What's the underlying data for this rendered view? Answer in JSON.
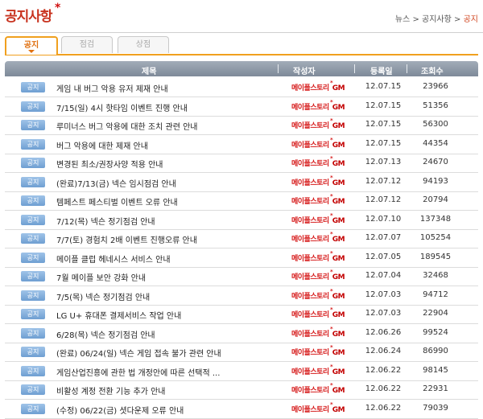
{
  "header": {
    "title": "공지사항",
    "title_star": "*",
    "breadcrumb": {
      "home": "뉴스",
      "sep1": " > ",
      "section": "공지사항",
      "sep2": " > ",
      "current": "공지"
    }
  },
  "tabs": [
    {
      "label": "공지",
      "active": true
    },
    {
      "label": "점검",
      "active": false
    },
    {
      "label": "상점",
      "active": false
    }
  ],
  "table": {
    "columns": {
      "subject": "제목",
      "author": "작성자",
      "date": "등록일",
      "views": "조회수"
    },
    "author_label": {
      "brand": "메이플스토리",
      "star": "*",
      "suffix": "GM"
    },
    "rows": [
      {
        "badge": "공지",
        "subject": "게임 내 버그 악용 유저 제재 안내",
        "date": "12.07.15",
        "views": "23966"
      },
      {
        "badge": "공지",
        "subject": "7/15(일) 4시 핫타임 이벤트 진행 안내",
        "date": "12.07.15",
        "views": "51356"
      },
      {
        "badge": "공지",
        "subject": "루미너스 버그 악용에 대한 조치 관련 안내",
        "date": "12.07.15",
        "views": "56300"
      },
      {
        "badge": "공지",
        "subject": "버그 악용에 대한 제재 안내",
        "date": "12.07.15",
        "views": "44354"
      },
      {
        "badge": "공지",
        "subject": "변경된 최소/권장사양 적용 안내",
        "date": "12.07.13",
        "views": "24670"
      },
      {
        "badge": "공지",
        "subject": "(완료)7/13(금) 넥슨 임시점검 안내",
        "date": "12.07.12",
        "views": "94193"
      },
      {
        "badge": "공지",
        "subject": "템페스트 페스티벌 이벤트 오류 안내",
        "date": "12.07.12",
        "views": "20794"
      },
      {
        "badge": "공지",
        "subject": "7/12(목) 넥슨 정기점검 안내",
        "date": "12.07.10",
        "views": "137348"
      },
      {
        "badge": "공지",
        "subject": "7/7(토) 경험치 2배 이벤트 진행오류 안내",
        "date": "12.07.07",
        "views": "105254"
      },
      {
        "badge": "공지",
        "subject": "메이플 클럽 헤네시스 서비스 안내",
        "date": "12.07.05",
        "views": "189545"
      },
      {
        "badge": "공지",
        "subject": "7월 메이플 보안 강화 안내",
        "date": "12.07.04",
        "views": "32468"
      },
      {
        "badge": "공지",
        "subject": "7/5(목) 넥슨 정기점검 안내",
        "date": "12.07.03",
        "views": "94712"
      },
      {
        "badge": "공지",
        "subject": "LG U+ 휴대폰 결제서비스 작업 안내",
        "date": "12.07.03",
        "views": "22904"
      },
      {
        "badge": "공지",
        "subject": "6/28(목) 넥슨 정기점검 안내",
        "date": "12.06.26",
        "views": "99524"
      },
      {
        "badge": "공지",
        "subject": "(완료) 06/24(일) 넥슨 게임 접속 불가 관련 안내",
        "date": "12.06.24",
        "views": "86990"
      },
      {
        "badge": "공지",
        "subject": "게임산업진흥에 관한 법 개정안에 따른 선택적 ...",
        "date": "12.06.22",
        "views": "98145"
      },
      {
        "badge": "공지",
        "subject": "비활성 계정 전환 기능 추가 안내",
        "date": "12.06.22",
        "views": "22931"
      },
      {
        "badge": "공지",
        "subject": "(수정) 06/22(금) 셧다운제 오류 안내",
        "date": "12.06.22",
        "views": "79039"
      }
    ]
  }
}
